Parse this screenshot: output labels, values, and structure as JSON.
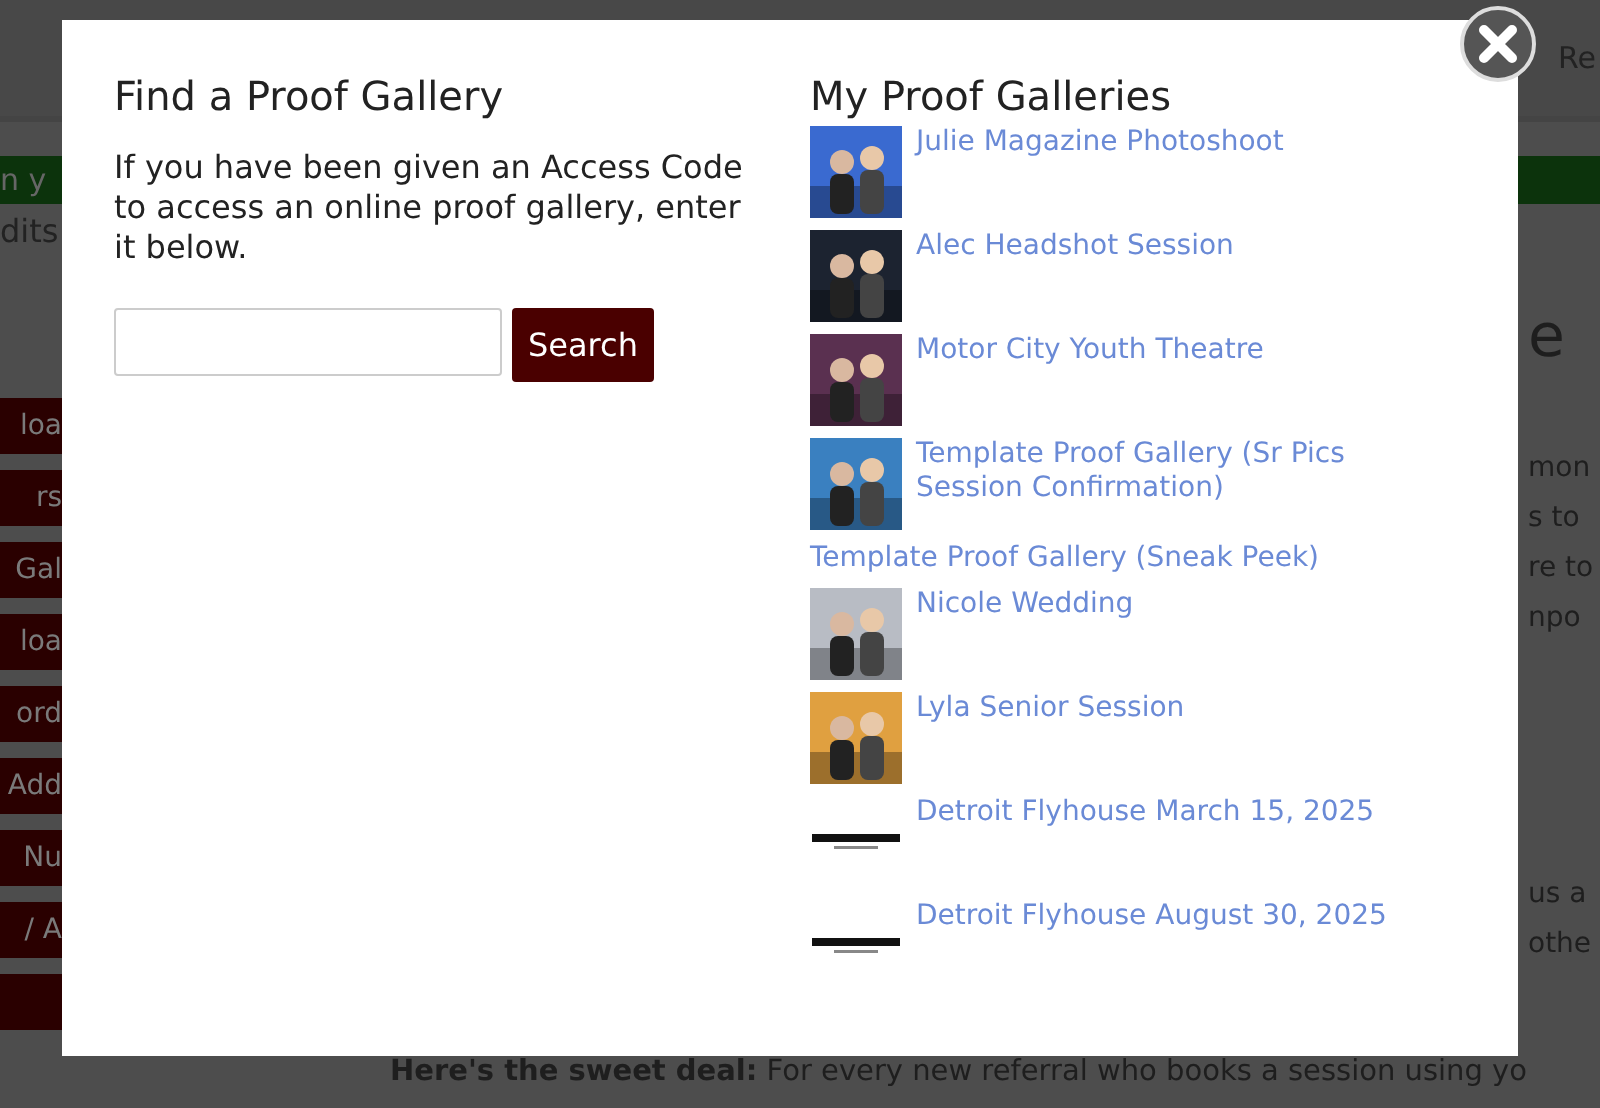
{
  "page": {
    "header_link": "Re",
    "notice": "n y",
    "credits": "dits",
    "sidebar_items": [
      "loa",
      "rs",
      "Gal",
      "loa",
      "ord",
      "Add",
      "Nu",
      "/ A"
    ],
    "heading_fragment": "e",
    "body_fragments": [
      "mon",
      "s to",
      "re to",
      "npo"
    ],
    "body_fragments_2": [
      "us a",
      "othe"
    ],
    "footer_text": "**Here's the sweet deal:** For every new referral who books a session using yo"
  },
  "dialog": {
    "find": {
      "title": "Find a Proof Gallery",
      "description": "If you have been given an Access Code to access an online proof gallery, enter it below.",
      "search_button": "Search"
    },
    "galleries": {
      "title": "My Proof Galleries",
      "items": [
        {
          "name": "Julie Magazine Photoshoot"
        },
        {
          "name": "Alec Headshot Session"
        },
        {
          "name": "Motor City Youth Theatre"
        },
        {
          "name": "Template Proof Gallery (Sr Pics Session Confirmation)"
        },
        {
          "name": "Template Proof Gallery (Sneak Peek)",
          "kind": "text"
        },
        {
          "name": "Nicole Wedding"
        },
        {
          "name": "Lyla Senior Session"
        },
        {
          "name": "Detroit Flyhouse March 15, 2025",
          "kind": "logo"
        },
        {
          "name": "Detroit Flyhouse August 30, 2025",
          "kind": "logo"
        }
      ]
    }
  }
}
